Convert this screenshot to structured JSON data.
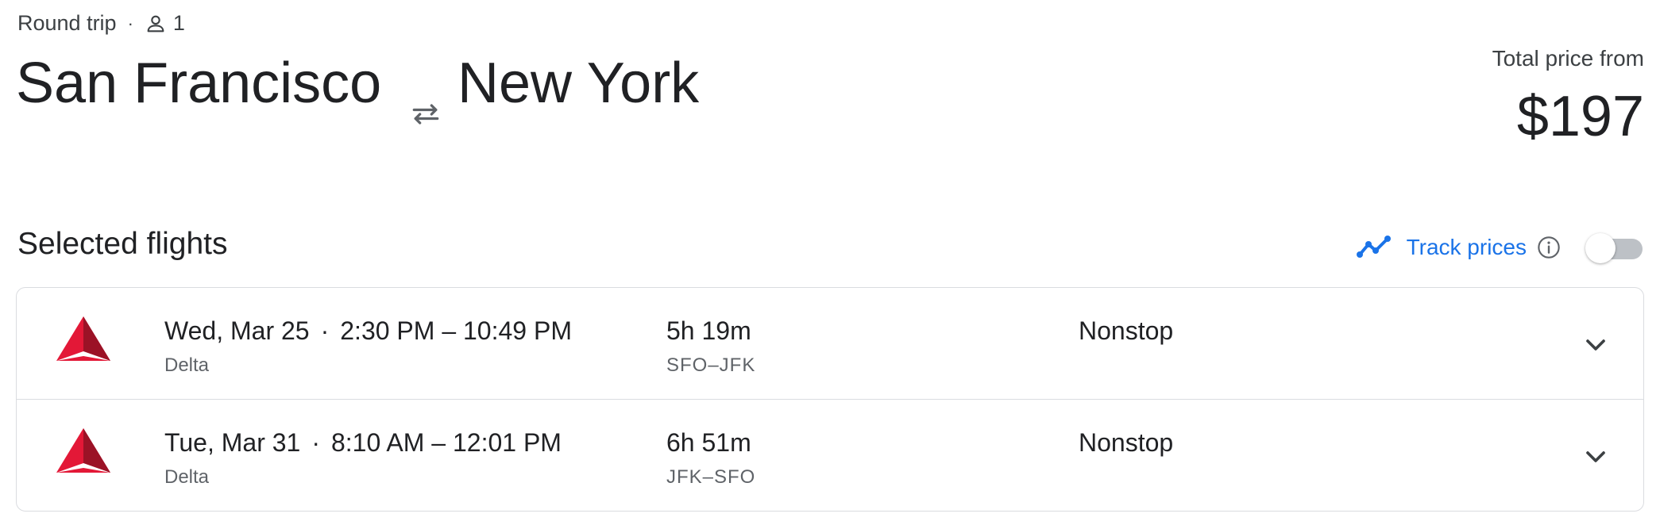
{
  "trip": {
    "type": "Round trip",
    "separator": "·",
    "passengers": "1",
    "person_icon": "person-icon"
  },
  "route": {
    "origin": "San Francisco",
    "destination": "New York",
    "swap_icon": "swap-arrows-icon"
  },
  "price": {
    "label": "Total price from",
    "value": "$197"
  },
  "selected_flights": {
    "title": "Selected flights",
    "track_label": "Track prices",
    "track_enabled": false,
    "accent_color": "#1a73e8"
  },
  "flights": [
    {
      "date": "Wed, Mar 25",
      "sep": "·",
      "times": "2:30 PM – 10:49 PM",
      "airline": "Delta",
      "duration": "5h 19m",
      "airports": "SFO–JFK",
      "stops": "Nonstop",
      "logo": "delta-logo-icon"
    },
    {
      "date": "Tue, Mar 31",
      "sep": "·",
      "times": "8:10 AM – 12:01 PM",
      "airline": "Delta",
      "duration": "6h 51m",
      "airports": "JFK–SFO",
      "stops": "Nonstop",
      "logo": "delta-logo-icon"
    }
  ],
  "colors": {
    "text": "#202124",
    "secondary": "#5f6368",
    "border": "#dadce0",
    "delta_red": "#c8102e",
    "delta_dark": "#8e0e1f"
  }
}
